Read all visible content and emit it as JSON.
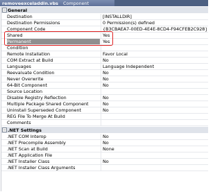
{
  "tab": {
    "file": "removeexceladdin.vbs",
    "label": "Component"
  },
  "categories": [
    {
      "label": "General",
      "toggle": "−"
    },
    {
      "label": ".NET Settings",
      "toggle": "−"
    }
  ],
  "general_rows": [
    {
      "name": "Destination",
      "value": "[INSTALLDIR]"
    },
    {
      "name": "Destination Permissions",
      "value": "0 Permission(s) defined"
    },
    {
      "name": "Component Code",
      "value": "{B3CBAEA7-00ED-4E4E-8CD4-F94CFEB2C928}"
    },
    {
      "name": "Shared",
      "value": "Yes"
    },
    {
      "name": "Permanent",
      "value": "Yes"
    },
    {
      "name": "Condition",
      "value": ""
    },
    {
      "name": "Remote Installation",
      "value": "Favor Local"
    },
    {
      "name": "COM Extract at Build",
      "value": "No"
    },
    {
      "name": "Languages",
      "value": "Language Independent"
    },
    {
      "name": "Reevaluate Condition",
      "value": "No"
    },
    {
      "name": "Never Overwrite",
      "value": "No"
    },
    {
      "name": "64-Bit Component",
      "value": "No"
    },
    {
      "name": "Source Location",
      "value": ""
    },
    {
      "name": "Disable Registry Reflection",
      "value": "No"
    },
    {
      "name": "Multiple Package Shared Component",
      "value": "No"
    },
    {
      "name": "Uninstall Superseded Component",
      "value": "No"
    },
    {
      "name": "REG File To Merge At Build",
      "value": ""
    },
    {
      "name": "Comments",
      "value": ""
    }
  ],
  "net_rows": [
    {
      "name": ".NET COM Interop",
      "value": "No"
    },
    {
      "name": ".NET Precompile Assembly",
      "value": "No"
    },
    {
      "name": ".NET Scan at Build",
      "value": "None"
    },
    {
      "name": ".NET Application File",
      "value": ""
    },
    {
      "name": ".NET Installer Class",
      "value": "No"
    },
    {
      "name": ".NET Installer Class Arguments",
      "value": ""
    }
  ],
  "selected_row": "Permanent",
  "colors": {
    "tab_bar": "#4d6082",
    "category_bg": "#dfe3ea",
    "selected_bg": "#8f8f8f",
    "highlight": "#e02020"
  }
}
